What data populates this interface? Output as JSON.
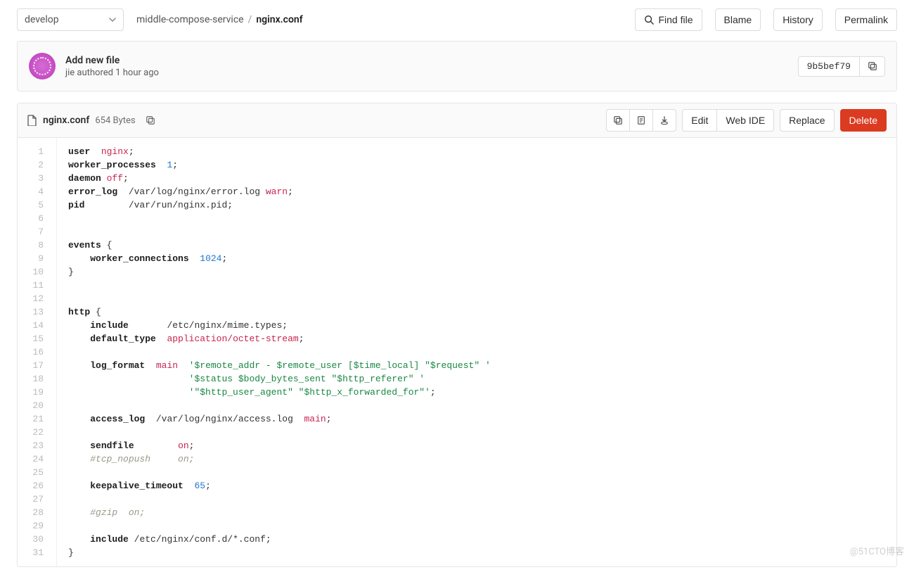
{
  "nav": {
    "branch": "develop",
    "breadcrumb": {
      "parent": "middle-compose-service",
      "sep": "/",
      "current": "nginx.conf"
    },
    "buttons": {
      "find_file": "Find file",
      "blame": "Blame",
      "history": "History",
      "permalink": "Permalink"
    }
  },
  "commit": {
    "title": "Add new file",
    "author": "jie",
    "verb": "authored",
    "time": "1 hour ago",
    "sha": "9b5bef79"
  },
  "file": {
    "name": "nginx.conf",
    "size": "654 Bytes",
    "actions": {
      "edit": "Edit",
      "web_ide": "Web IDE",
      "replace": "Replace",
      "delete": "Delete"
    }
  },
  "code": {
    "line_count": 31,
    "lines": [
      [
        [
          "kw",
          "user"
        ],
        [
          "sp",
          "  "
        ],
        [
          "val",
          "nginx"
        ],
        [
          "punct",
          ";"
        ]
      ],
      [
        [
          "kw",
          "worker_processes"
        ],
        [
          "sp",
          "  "
        ],
        [
          "num",
          "1"
        ],
        [
          "punct",
          ";"
        ]
      ],
      [
        [
          "kw",
          "daemon"
        ],
        [
          "sp",
          " "
        ],
        [
          "val",
          "off"
        ],
        [
          "punct",
          ";"
        ]
      ],
      [
        [
          "kw",
          "error_log"
        ],
        [
          "sp",
          "  "
        ],
        [
          "txt",
          "/var/log/nginx/error.log "
        ],
        [
          "val",
          "warn"
        ],
        [
          "punct",
          ";"
        ]
      ],
      [
        [
          "kw",
          "pid"
        ],
        [
          "sp",
          "        "
        ],
        [
          "txt",
          "/var/run/nginx.pid"
        ],
        [
          "punct",
          ";"
        ]
      ],
      [],
      [],
      [
        [
          "kw",
          "events"
        ],
        [
          "sp",
          " "
        ],
        [
          "punct",
          "{"
        ]
      ],
      [
        [
          "sp",
          "    "
        ],
        [
          "kw",
          "worker_connections"
        ],
        [
          "sp",
          "  "
        ],
        [
          "num",
          "1024"
        ],
        [
          "punct",
          ";"
        ]
      ],
      [
        [
          "punct",
          "}"
        ]
      ],
      [],
      [],
      [
        [
          "kw",
          "http"
        ],
        [
          "sp",
          " "
        ],
        [
          "punct",
          "{"
        ]
      ],
      [
        [
          "sp",
          "    "
        ],
        [
          "kw",
          "include"
        ],
        [
          "sp",
          "       "
        ],
        [
          "txt",
          "/etc/nginx/mime.types"
        ],
        [
          "punct",
          ";"
        ]
      ],
      [
        [
          "sp",
          "    "
        ],
        [
          "kw",
          "default_type"
        ],
        [
          "sp",
          "  "
        ],
        [
          "val",
          "application/octet-stream"
        ],
        [
          "punct",
          ";"
        ]
      ],
      [],
      [
        [
          "sp",
          "    "
        ],
        [
          "kw",
          "log_format"
        ],
        [
          "sp",
          "  "
        ],
        [
          "val",
          "main"
        ],
        [
          "sp",
          "  "
        ],
        [
          "str",
          "'$remote_addr - $remote_user [$time_local] \"$request\" '"
        ]
      ],
      [
        [
          "sp",
          "                      "
        ],
        [
          "str",
          "'$status $body_bytes_sent \"$http_referer\" '"
        ]
      ],
      [
        [
          "sp",
          "                      "
        ],
        [
          "str",
          "'\"$http_user_agent\" \"$http_x_forwarded_for\"'"
        ],
        [
          "punct",
          ";"
        ]
      ],
      [],
      [
        [
          "sp",
          "    "
        ],
        [
          "kw",
          "access_log"
        ],
        [
          "sp",
          "  "
        ],
        [
          "txt",
          "/var/log/nginx/access.log  "
        ],
        [
          "val",
          "main"
        ],
        [
          "punct",
          ";"
        ]
      ],
      [],
      [
        [
          "sp",
          "    "
        ],
        [
          "kw",
          "sendfile"
        ],
        [
          "sp",
          "        "
        ],
        [
          "val",
          "on"
        ],
        [
          "punct",
          ";"
        ]
      ],
      [
        [
          "sp",
          "    "
        ],
        [
          "cmt",
          "#tcp_nopush     on;"
        ]
      ],
      [],
      [
        [
          "sp",
          "    "
        ],
        [
          "kw",
          "keepalive_timeout"
        ],
        [
          "sp",
          "  "
        ],
        [
          "num",
          "65"
        ],
        [
          "punct",
          ";"
        ]
      ],
      [],
      [
        [
          "sp",
          "    "
        ],
        [
          "cmt",
          "#gzip  on;"
        ]
      ],
      [],
      [
        [
          "sp",
          "    "
        ],
        [
          "kw",
          "include"
        ],
        [
          "sp",
          " "
        ],
        [
          "txt",
          "/etc/nginx/conf.d/*.conf"
        ],
        [
          "punct",
          ";"
        ]
      ],
      [
        [
          "punct",
          "}"
        ]
      ]
    ]
  },
  "watermark": "@51CTO博客"
}
